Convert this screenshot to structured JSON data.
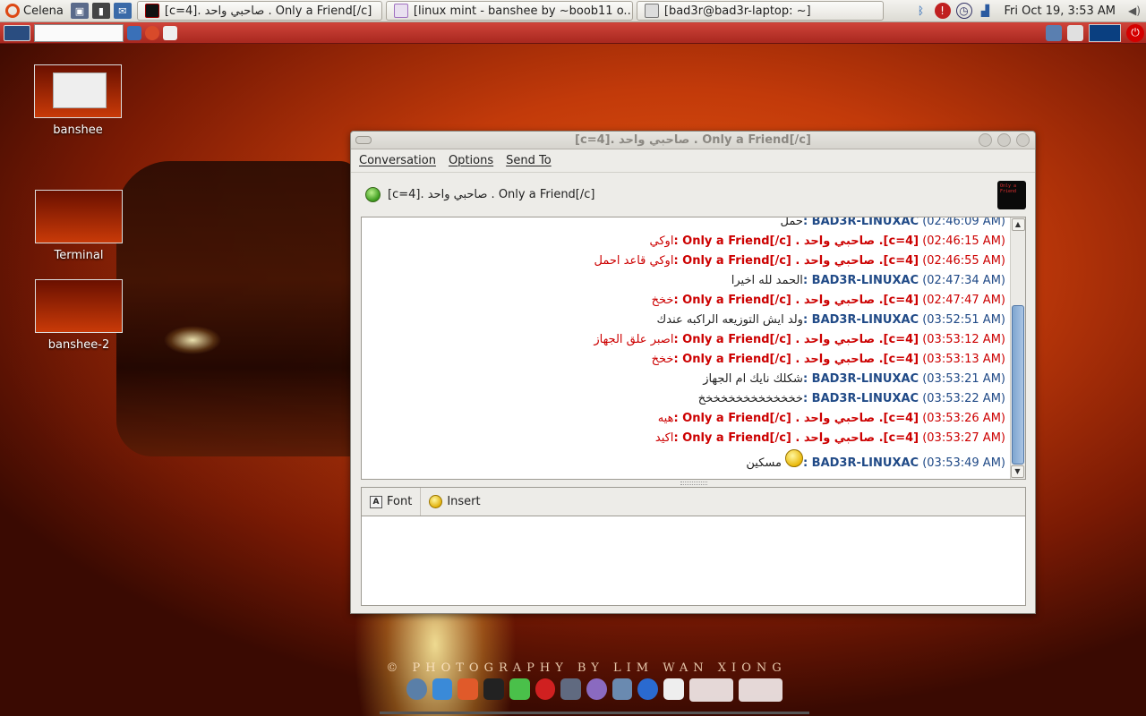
{
  "top_panel": {
    "menu_label": "Celena",
    "tasks": [
      {
        "label": "[c=4]. صاحبي واحد . Only a Friend[/c]"
      },
      {
        "label": "[linux mint - banshee by ~boob11 o..."
      },
      {
        "label": "[bad3r@bad3r-laptop: ~]"
      }
    ],
    "clock": "Fri Oct 19,  3:53 AM"
  },
  "desktop_icons": [
    {
      "label": "banshee"
    },
    {
      "label": "Terminal"
    },
    {
      "label": "banshee-2"
    }
  ],
  "wallpaper": {
    "credit": "© PHOTOGRAPHY BY LIM WAN XIONG"
  },
  "chat_window": {
    "title": "[c=4]. صاحبي واحد . Only a Friend[/c]",
    "menu": [
      "Conversation",
      "Options",
      "Send To"
    ],
    "buddy_name": "[c=4]. صاحبي واحد . Only a Friend[/c]",
    "buddy_icon_text": "Only a Friend",
    "messages": [
      {
        "sender": "self",
        "time": "(02:46:09 AM)",
        "name": "BAD3R-LINUXAC",
        "text": "حمل"
      },
      {
        "sender": "buddy",
        "time": "(02:46:15 AM)",
        "name": "Only a Friend[/c] . صاحبي واحد .[c=4]",
        "text": "اوكي"
      },
      {
        "sender": "buddy",
        "time": "(02:46:55 AM)",
        "name": "Only a Friend[/c] . صاحبي واحد .[c=4]",
        "text": "اوكي قاعد احمل"
      },
      {
        "sender": "self",
        "time": "(02:47:34 AM)",
        "name": "BAD3R-LINUXAC",
        "text": "الحمد لله اخيرا"
      },
      {
        "sender": "buddy",
        "time": "(02:47:47 AM)",
        "name": "Only a Friend[/c] . صاحبي واحد .[c=4]",
        "text": "خخخ"
      },
      {
        "sender": "self",
        "time": "(03:52:51 AM)",
        "name": "BAD3R-LINUXAC",
        "text": "ولد ايش التوزيعه الراكبه عندك"
      },
      {
        "sender": "buddy",
        "time": "(03:53:12 AM)",
        "name": "Only a Friend[/c] . صاحبي واحد .[c=4]",
        "text": "اصبر علق الجهاز"
      },
      {
        "sender": "buddy",
        "time": "(03:53:13 AM)",
        "name": "Only a Friend[/c] . صاحبي واحد .[c=4]",
        "text": "خخخ"
      },
      {
        "sender": "self",
        "time": "(03:53:21 AM)",
        "name": "BAD3R-LINUXAC",
        "text": "شكلك نايك ام الجهاز"
      },
      {
        "sender": "self",
        "time": "(03:53:22 AM)",
        "name": "BAD3R-LINUXAC",
        "text": "خخخخخخخخخخخخخخ"
      },
      {
        "sender": "buddy",
        "time": "(03:53:26 AM)",
        "name": "Only a Friend[/c] . صاحبي واحد .[c=4]",
        "text": "هيه"
      },
      {
        "sender": "buddy",
        "time": "(03:53:27 AM)",
        "name": "Only a Friend[/c] . صاحبي واحد .[c=4]",
        "text": "اكيد"
      },
      {
        "sender": "self",
        "time": "(03:53:49 AM)",
        "name": "BAD3R-LINUXAC",
        "text": "مسكين",
        "smiley": true
      }
    ],
    "format_bar": {
      "font_label": "Font",
      "insert_label": "Insert"
    },
    "entry_value": ""
  },
  "colors": {
    "self_name": "#204a87",
    "buddy_name": "#cc0000",
    "panel_bg": "#e8e6e0"
  }
}
